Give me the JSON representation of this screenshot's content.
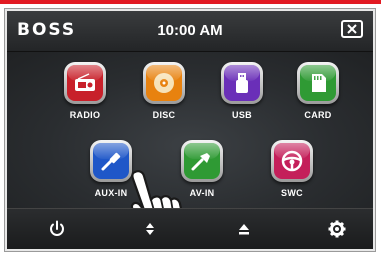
{
  "header": {
    "brand": "BOSS",
    "time": "10:00 AM",
    "close_icon": "close-window-icon"
  },
  "apps": [
    {
      "label": "RADIO",
      "icon": "radio-icon",
      "color": "#c8202a"
    },
    {
      "label": "DISC",
      "icon": "disc-icon",
      "color": "#e8820f"
    },
    {
      "label": "USB",
      "icon": "usb-icon",
      "color": "#6a2fb8"
    },
    {
      "label": "CARD",
      "icon": "sd-card-icon",
      "color": "#2f9a34"
    },
    {
      "label": "AUX-IN",
      "icon": "aux-jack-icon",
      "color": "#1f57c8"
    },
    {
      "label": "AV-IN",
      "icon": "av-plug-icon",
      "color": "#2f9a34"
    },
    {
      "label": "SWC",
      "icon": "steering-wheel-icon",
      "color": "#c41f5a"
    }
  ],
  "footer": {
    "items": [
      "power-icon",
      "up-down-arrows-icon",
      "eject-icon",
      "gear-icon"
    ]
  },
  "overlay": "pointing-hand-icon"
}
